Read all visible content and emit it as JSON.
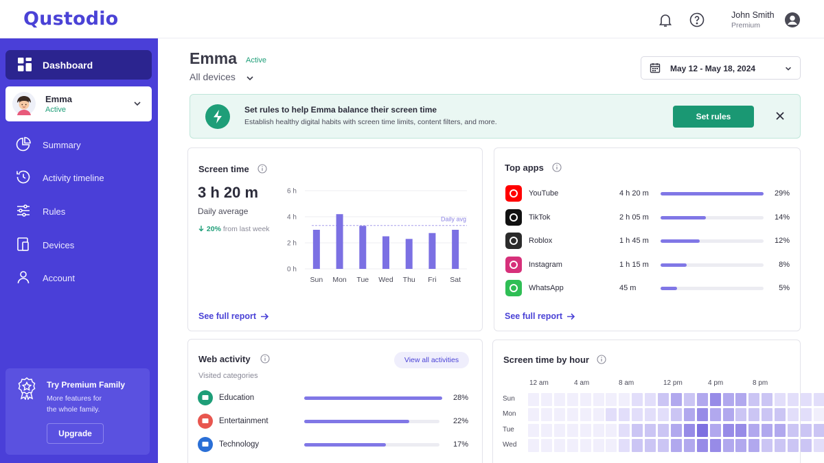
{
  "app": {
    "logo": "Qustodio"
  },
  "header": {
    "user_name": "John Smith",
    "user_plan": "Premium",
    "icons": [
      "bell-icon",
      "help-icon",
      "account-icon"
    ]
  },
  "sidebar": {
    "dashboard_label": "Dashboard",
    "profile": {
      "name": "Emma",
      "status": "Active"
    },
    "items": [
      {
        "label": "Summary",
        "icon": "pie-chart-icon"
      },
      {
        "label": "Activity timeline",
        "icon": "history-icon"
      },
      {
        "label": "Rules",
        "icon": "sliders-icon"
      },
      {
        "label": "Devices",
        "icon": "devices-icon"
      },
      {
        "label": "Account",
        "icon": "user-icon"
      }
    ],
    "premium": {
      "title": "Try Premium Family",
      "desc_line1": "More features for",
      "desc_line2": "the whole family.",
      "button": "Upgrade"
    }
  },
  "main": {
    "child_name": "Emma",
    "child_status": "Active",
    "devices_label": "All devices",
    "date_range": "May 12 - May 18, 2024"
  },
  "banner": {
    "title": "Set rules to help Emma balance their screen time",
    "desc": "Establish healthy digital habits with screen time limits, content filters, and more.",
    "button": "Set rules"
  },
  "screen_time": {
    "title": "Screen time",
    "total": "3 h 20 m",
    "subtitle": "Daily average",
    "delta_pct": "20%",
    "delta_text": "from last week",
    "see_report": "See full report",
    "chart_data": {
      "type": "bar",
      "categories": [
        "Sun",
        "Mon",
        "Tue",
        "Wed",
        "Thu",
        "Fri",
        "Sat"
      ],
      "values": [
        3.0,
        4.2,
        3.3,
        2.5,
        2.3,
        2.75,
        3.0
      ],
      "ylim": [
        0,
        6
      ],
      "yticks": [
        "0 h",
        "2 h",
        "4 h",
        "6 h"
      ],
      "ytick_values": [
        0,
        2,
        4,
        6
      ],
      "reference_line": {
        "label": "Daily avg",
        "value": 3.33
      },
      "color": "#7b70e3"
    }
  },
  "top_apps": {
    "title": "Top apps",
    "see_report": "See full report",
    "items": [
      {
        "name": "YouTube",
        "time": "4 h 20 m",
        "pct": "29%",
        "fraction": 1.0,
        "icon": "youtube-icon",
        "color": "#ff0000"
      },
      {
        "name": "TikTok",
        "time": "2 h 05 m",
        "pct": "14%",
        "fraction": 0.44,
        "icon": "tiktok-icon",
        "color": "#111111"
      },
      {
        "name": "Roblox",
        "time": "1 h 45 m",
        "pct": "12%",
        "fraction": 0.38,
        "icon": "roblox-icon",
        "color": "#2b2b2b"
      },
      {
        "name": "Instagram",
        "time": "1 h 15 m",
        "pct": "8%",
        "fraction": 0.25,
        "icon": "instagram-icon",
        "color": "#d6307a"
      },
      {
        "name": "WhatsApp",
        "time": "45 m",
        "pct": "5%",
        "fraction": 0.16,
        "icon": "whatsapp-icon",
        "color": "#2fbe55"
      }
    ]
  },
  "web_activity": {
    "title": "Web activity",
    "view_all": "View all activities",
    "subtitle": "Visited categories",
    "items": [
      {
        "name": "Education",
        "pct": "28%",
        "fraction": 1.0,
        "icon": "education-icon",
        "color": "#1e9e78"
      },
      {
        "name": "Entertainment",
        "pct": "22%",
        "fraction": 0.76,
        "icon": "entertainment-icon",
        "color": "#e8564f"
      },
      {
        "name": "Technology",
        "pct": "17%",
        "fraction": 0.59,
        "icon": "technology-icon",
        "color": "#2a6fd6"
      }
    ]
  },
  "heatmap": {
    "title": "Screen time by hour",
    "hour_labels": [
      "12 am",
      "4 am",
      "8 am",
      "12 pm",
      "4 pm",
      "8 pm"
    ],
    "days": [
      "Sun",
      "Mon",
      "Tue",
      "Wed"
    ],
    "levels": [
      [
        1,
        1,
        1,
        1,
        1,
        1,
        1,
        1,
        2,
        2,
        3,
        4,
        3,
        4,
        5,
        4,
        4,
        3,
        3,
        2,
        2,
        2,
        2,
        3
      ],
      [
        1,
        1,
        1,
        1,
        1,
        1,
        2,
        2,
        2,
        2,
        2,
        3,
        4,
        5,
        4,
        4,
        3,
        3,
        3,
        3,
        2,
        2,
        1,
        1
      ],
      [
        1,
        1,
        1,
        1,
        1,
        1,
        1,
        2,
        3,
        3,
        3,
        4,
        5,
        6,
        4,
        5,
        5,
        4,
        4,
        4,
        3,
        3,
        3,
        4
      ],
      [
        1,
        1,
        1,
        1,
        1,
        1,
        1,
        2,
        3,
        3,
        3,
        4,
        4,
        5,
        5,
        4,
        4,
        4,
        3,
        3,
        3,
        3,
        2,
        2
      ]
    ],
    "palette": [
      "#ffffff",
      "#f1effc",
      "#e2defa",
      "#cbc5f4",
      "#b1a8ee",
      "#978be7",
      "#7e71e0"
    ]
  }
}
